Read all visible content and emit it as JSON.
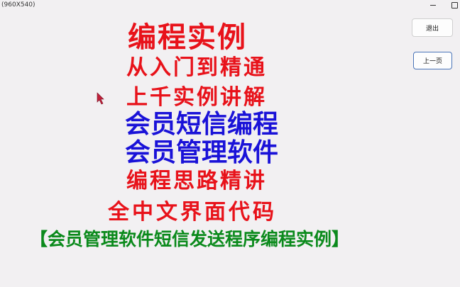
{
  "window": {
    "title": "(960X540)"
  },
  "buttons": {
    "exit_label": "退出",
    "prev_label": "上一页"
  },
  "content": {
    "lines": [
      "编程实例",
      "从入门到精通",
      "上千实例讲解",
      "会员短信编程",
      "会员管理软件",
      "编程思路精讲",
      "全中文界面代码",
      "【会员管理软件短信发送程序编程实例】"
    ]
  },
  "colors": {
    "red_text": "#e8121a",
    "blue_text": "#1a12d8",
    "green_text": "#0b8a1c",
    "background": "#f2f0f2",
    "cursor": "#c0203a"
  }
}
